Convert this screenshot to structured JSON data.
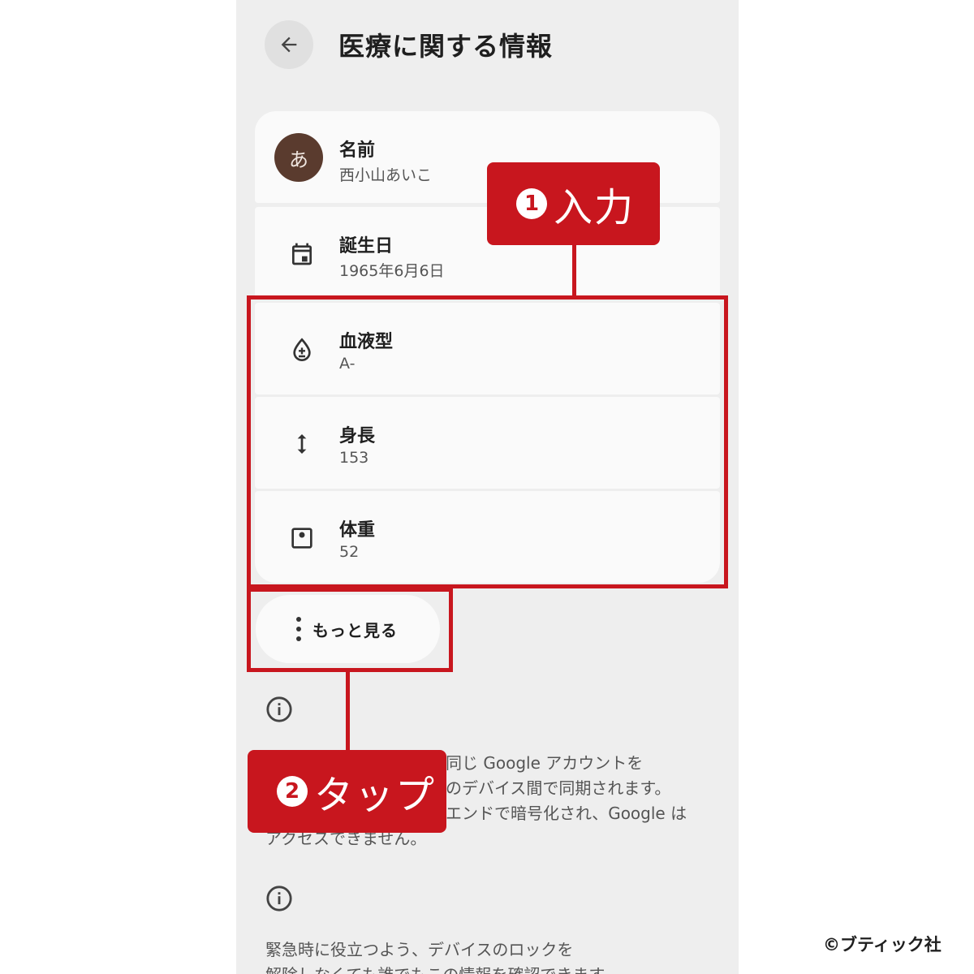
{
  "header": {
    "title": "医療に関する情報",
    "back_icon": "arrow-left-icon"
  },
  "profile": {
    "avatar_letter": "あ",
    "avatar_color": "#5a3b2e",
    "rows": [
      {
        "id": "name",
        "icon": "avatar",
        "title": "名前",
        "value": "西小山あいこ"
      },
      {
        "id": "birthday",
        "icon": "calendar-icon",
        "title": "誕生日",
        "value": "1965年6月6日"
      },
      {
        "id": "blood-type",
        "icon": "blood-drop-icon",
        "title": "血液型",
        "value": "A-"
      },
      {
        "id": "height",
        "icon": "vertical-arrows-icon",
        "title": "身長",
        "value": "153"
      },
      {
        "id": "weight",
        "icon": "scale-icon",
        "title": "体重",
        "value": "52"
      }
    ]
  },
  "more_button": {
    "label": "もっと見る",
    "icon": "more-vert-icon"
  },
  "info_1": {
    "icon": "info-icon",
    "lines": [
      "同じ Google アカウントを",
      "のデバイス間で同期されます。",
      "エンドで暗号化され、Google は",
      "アクセスできません。"
    ]
  },
  "info_2": {
    "icon": "info-icon",
    "lines": [
      "緊急時に役立つよう、デバイスのロックを",
      "解除しなくても誰でもこの情報を確認できます"
    ]
  },
  "annotations": {
    "accent_color": "#c8161e",
    "callout_1": {
      "number": "1",
      "label": "入力"
    },
    "callout_2": {
      "number": "2",
      "label": "タップ"
    }
  },
  "copyright": "©ブティック社"
}
